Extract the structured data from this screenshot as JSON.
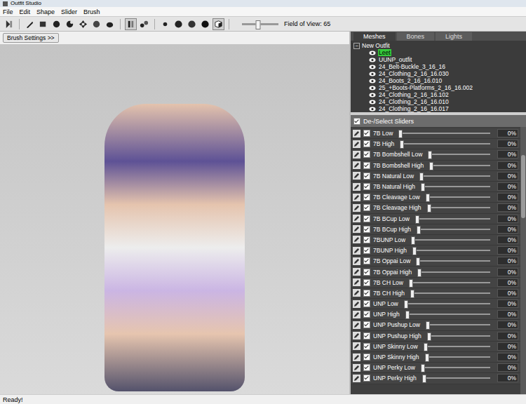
{
  "window": {
    "title": "Outfit Studio"
  },
  "menu": [
    "File",
    "Edit",
    "Shape",
    "Slider",
    "Brush"
  ],
  "toolbar": {
    "buttons": [
      {
        "kind": "logo",
        "selected": false
      },
      {
        "kind": "select",
        "selected": false
      },
      {
        "kind": "mask",
        "selected": false
      },
      {
        "kind": "inflate",
        "selected": false
      },
      {
        "kind": "deflate",
        "selected": false
      },
      {
        "kind": "move",
        "selected": false
      },
      {
        "kind": "smooth",
        "selected": false
      },
      {
        "kind": "weight",
        "selected": false
      },
      {
        "kind": "mirror",
        "selected": true
      },
      {
        "kind": "connect",
        "selected": false
      },
      {
        "kind": "vertex",
        "selected": false
      },
      {
        "kind": "shaded",
        "selected": false
      },
      {
        "kind": "wire",
        "selected": false
      },
      {
        "kind": "texture",
        "selected": false
      },
      {
        "kind": "cube",
        "selected": true
      }
    ],
    "fov": {
      "label": "Field of View: 65",
      "level": 0.45
    }
  },
  "brush_settings": "Brush Settings >>",
  "tabs": [
    {
      "label": "Meshes",
      "selected": true
    },
    {
      "label": "Bones",
      "selected": false
    },
    {
      "label": "Lights",
      "selected": false
    }
  ],
  "tree": {
    "root": "New Outfit",
    "expanded": true,
    "expander": "−",
    "items": [
      {
        "name": "Leet",
        "visible": true,
        "selected": true
      },
      {
        "name": "UUNP_outfit",
        "visible": true,
        "selected": false
      },
      {
        "name": "24_Belt-Buckle_3_16_16",
        "visible": true,
        "selected": false
      },
      {
        "name": "24_Clothing_2_16_16.030",
        "visible": true,
        "selected": false
      },
      {
        "name": "24_Boots_2_16_16.010",
        "visible": true,
        "selected": false
      },
      {
        "name": "25_+Boots-Platforms_2_16_16.002",
        "visible": true,
        "selected": false
      },
      {
        "name": "24_Clothing_2_16_16.102",
        "visible": true,
        "selected": false
      },
      {
        "name": "24_Clothing_2_16_16.010",
        "visible": true,
        "selected": false
      },
      {
        "name": "24_Clothing_2_16_16.017",
        "visible": true,
        "selected": false
      }
    ]
  },
  "sliders_header": {
    "label": "De-/Select Sliders",
    "checked": true
  },
  "sliders": [
    {
      "name": "7B Low",
      "checked": true,
      "level": 0,
      "value": "0%"
    },
    {
      "name": "7B High",
      "checked": true,
      "level": 0,
      "value": "0%"
    },
    {
      "name": "7B Bombshell Low",
      "checked": true,
      "level": 0,
      "value": "0%"
    },
    {
      "name": "7B Bombshell High",
      "checked": true,
      "level": 0,
      "value": "0%"
    },
    {
      "name": "7B Natural Low",
      "checked": true,
      "level": 0,
      "value": "0%"
    },
    {
      "name": "7B Natural High",
      "checked": true,
      "level": 0,
      "value": "0%"
    },
    {
      "name": "7B Cleavage Low",
      "checked": true,
      "level": 0,
      "value": "0%"
    },
    {
      "name": "7B Cleavage High",
      "checked": true,
      "level": 0,
      "value": "0%"
    },
    {
      "name": "7B BCup Low",
      "checked": true,
      "level": 0,
      "value": "0%"
    },
    {
      "name": "7B BCup High",
      "checked": true,
      "level": 0,
      "value": "0%"
    },
    {
      "name": "7BUNP Low",
      "checked": true,
      "level": 0,
      "value": "0%"
    },
    {
      "name": "7BUNP High",
      "checked": true,
      "level": 0,
      "value": "0%"
    },
    {
      "name": "7B Oppai Low",
      "checked": true,
      "level": 0,
      "value": "0%"
    },
    {
      "name": "7B Oppai High",
      "checked": true,
      "level": 0,
      "value": "0%"
    },
    {
      "name": "7B CH Low",
      "checked": true,
      "level": 0,
      "value": "0%"
    },
    {
      "name": "7B CH High",
      "checked": true,
      "level": 0,
      "value": "0%"
    },
    {
      "name": "UNP Low",
      "checked": true,
      "level": 0,
      "value": "0%"
    },
    {
      "name": "UNP High",
      "checked": true,
      "level": 0,
      "value": "0%"
    },
    {
      "name": "UNP Pushup Low",
      "checked": true,
      "level": 0,
      "value": "0%"
    },
    {
      "name": "UNP Pushup High",
      "checked": true,
      "level": 0,
      "value": "0%"
    },
    {
      "name": "UNP Skinny Low",
      "checked": true,
      "level": 0,
      "value": "0%"
    },
    {
      "name": "UNP Skinny High",
      "checked": true,
      "level": 0,
      "value": "0%"
    },
    {
      "name": "UNP Perky Low",
      "checked": true,
      "level": 0,
      "value": "0%"
    },
    {
      "name": "UNP Perky High",
      "checked": true,
      "level": 0,
      "value": "0%"
    }
  ],
  "status_bar": "Ready!"
}
